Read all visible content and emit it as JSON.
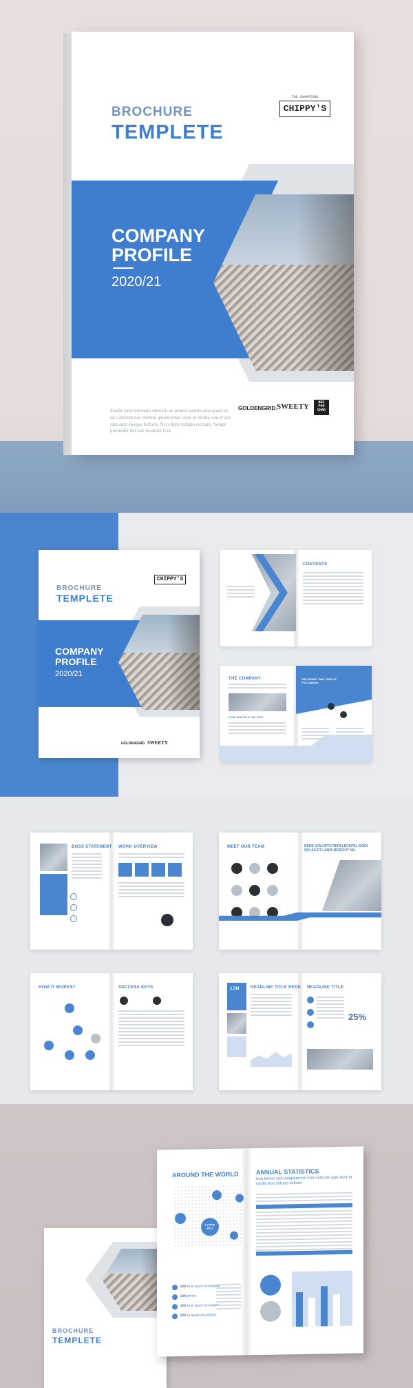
{
  "cover": {
    "brochure": "BROCHURE",
    "templete": "TEMPLETE",
    "company": "COMPANY",
    "profile": "PROFILE",
    "year": "2020/21",
    "brand_tag": "THE CHAMPIONS",
    "brand": "CHIPPY'S",
    "logo_golden": "GOLDENGRID.",
    "logo_sweety": "SWEETY",
    "stamp": "BEE\nPAD\nCHAD",
    "footer": "Estelit tam venianam seturalit ne prored quatim erus quant us ed t alterum nos portum quinitvertad conn ut mintia tum et ant ram aum epoque ferforts. Nat ellum volupte rectium. Volupt pierunder dut non moduter fora."
  },
  "spreads": {
    "contents": "CONTENTS",
    "the_company": "THE COMPANY",
    "vision": "OUR VISION & VALUES",
    "the_money": "THE MONEY WILL END UP FOLLOWING.",
    "boss": "BOSS STATEMENT",
    "work_overview": "WORK OVERVIEW",
    "meet_team": "MEET OUR TEAM",
    "quote": "BERE GOLUPTU REPELECEPEL MODI QUI AS ET LANDI BERCIUT NIL",
    "how_it_works": "HOW IT WORKS?",
    "success_keys": "SUCCESS KEYS",
    "headline_a": "HEADLINE TITLE HERE",
    "headline_b": "HEADLINE TITLE",
    "headline_pct": "25%",
    "headline_badge": "1.5M",
    "around_world": "AROUND THE WORLD",
    "annual_stats": "ANNUAL STATISTICS",
    "annual_sub": "Ima lelnce volt solapluerem mer volorum quo sbor et cuntis tion setuno sellore",
    "year_bubble": "London 2017",
    "stats": [
      {
        "value": "200",
        "text": "et et quunt acculaptai"
      },
      {
        "value": "300",
        "text": "ponot"
      },
      {
        "value": "100",
        "text": "et et quunt acculaptai"
      },
      {
        "value": "800",
        "text": "et quunt acculaptai"
      }
    ],
    "back_brochure": "BROCHURE",
    "back_templete": "TEMPLETE"
  },
  "colors": {
    "accent": "#3f7ece",
    "light": "#cfdff1"
  }
}
